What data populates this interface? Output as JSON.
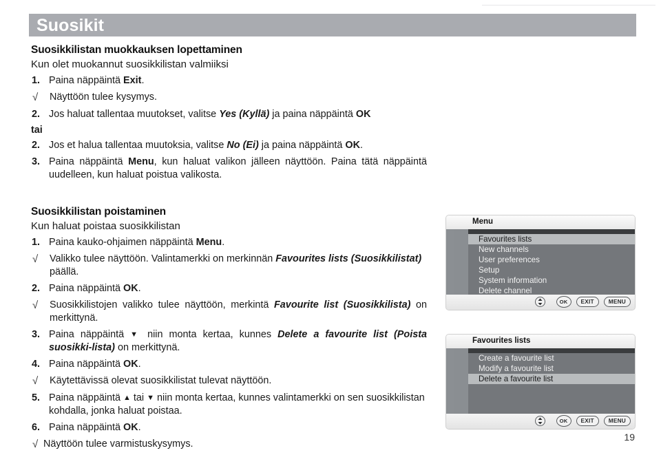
{
  "page": {
    "number": "19",
    "header_title": "Suosikit"
  },
  "sections": [
    {
      "heading": "Suosikkilistan muokkauksen lopettaminen",
      "subheading": "Kun olet muokannut suosikkilistan valmiiksi",
      "items": [
        {
          "marker": "1.",
          "type": "num",
          "html": "Paina näppäintä <b>Exit</b>."
        },
        {
          "marker": "√",
          "type": "check",
          "html": "Näyttöön tulee kysymys."
        },
        {
          "marker": "2.",
          "type": "num",
          "html": "Jos haluat tallentaa muutokset, valitse <i class=\"bi\">Yes (Kyllä)</i> ja paina näppäintä <b>OK</b>"
        },
        {
          "marker": "",
          "type": "plain",
          "html": "tai"
        },
        {
          "marker": "2.",
          "type": "num",
          "html": "Jos et halua tallentaa muutoksia, valitse <i class=\"bi\">No (Ei)</i> ja paina näppäintä <b>OK</b>."
        },
        {
          "marker": "3.",
          "type": "num",
          "justify": true,
          "html": "Paina näppäintä <b>Menu</b>, kun haluat valikon jälleen näyttöön. Paina tätä näppäintä uudelleen, kun haluat poistua valikosta."
        }
      ]
    },
    {
      "heading": "Suosikkilistan poistaminen",
      "subheading": "Kun haluat poistaa suosikkilistan",
      "items": [
        {
          "marker": "1.",
          "type": "num",
          "html": "Paina kauko-ohjaimen näppäintä <b>Menu</b>."
        },
        {
          "marker": "√",
          "type": "check",
          "html": "Valikko tulee näyttöön. Valintamerkki on merkinnän <i class=\"bi\">Favourites lists (Suosikkilistat)</i> päällä."
        },
        {
          "marker": "2.",
          "type": "num",
          "html": "Paina näppäintä <b>OK</b>."
        },
        {
          "marker": "√",
          "type": "check",
          "justify": true,
          "html": "Suosikkilistojen valikko tulee näyttöön, merkintä <i class=\"bi\">Favourite list (Suosikkilista)</i> on merkittynä."
        },
        {
          "marker": "3.",
          "type": "num",
          "justify": true,
          "html": "Paina näppäintä <span class=\"arrow\">▼</span> niin monta kertaa, kunnes <i class=\"bi\">Delete a favourite list (Poista suosikki-lista)</i> on merkittynä."
        },
        {
          "marker": "4.",
          "type": "num",
          "html": "Paina näppäintä <b>OK</b>."
        },
        {
          "marker": "√",
          "type": "check",
          "html": "Käytettävissä olevat suosikkilistat tulevat näyttöön."
        },
        {
          "marker": "5.",
          "type": "num",
          "html": "Paina näppäintä <span class=\"arrow\">▲</span> tai <span class=\"arrow\">▼</span> niin monta kertaa, kunnes valintamerkki on sen suosikkilistan kohdalla, jonka haluat poistaa."
        },
        {
          "marker": "6.",
          "type": "num",
          "html": "Paina näppäintä <b>OK</b>."
        },
        {
          "marker": "√",
          "type": "check-tight",
          "html": "Näyttöön tulee varmistuskysymys."
        }
      ]
    }
  ],
  "screens": [
    {
      "title": "Menu",
      "items": [
        {
          "label": "Favourites lists",
          "selected": true
        },
        {
          "label": "New channels",
          "selected": false
        },
        {
          "label": "User preferences",
          "selected": false
        },
        {
          "label": "Setup",
          "selected": false
        },
        {
          "label": "System information",
          "selected": false
        },
        {
          "label": "Delete channel",
          "selected": false
        }
      ],
      "footer": {
        "nav_icon": "up-down-arrow-icon",
        "buttons": [
          "OK",
          "EXIT",
          "MENU"
        ]
      }
    },
    {
      "title": "Favourites lists",
      "items": [
        {
          "label": "Create a favourite list",
          "selected": false
        },
        {
          "label": "Modify a favourite list",
          "selected": false
        },
        {
          "label": "Delete a favourite list",
          "selected": true
        }
      ],
      "footer": {
        "nav_icon": "up-down-arrow-icon",
        "buttons": [
          "OK",
          "EXIT",
          "MENU"
        ]
      }
    }
  ],
  "colors": {
    "header_bar": "#a9abb0",
    "screen_bg": "#919599",
    "screen_panel": "#74777b",
    "selection": "#b9bcbe"
  }
}
